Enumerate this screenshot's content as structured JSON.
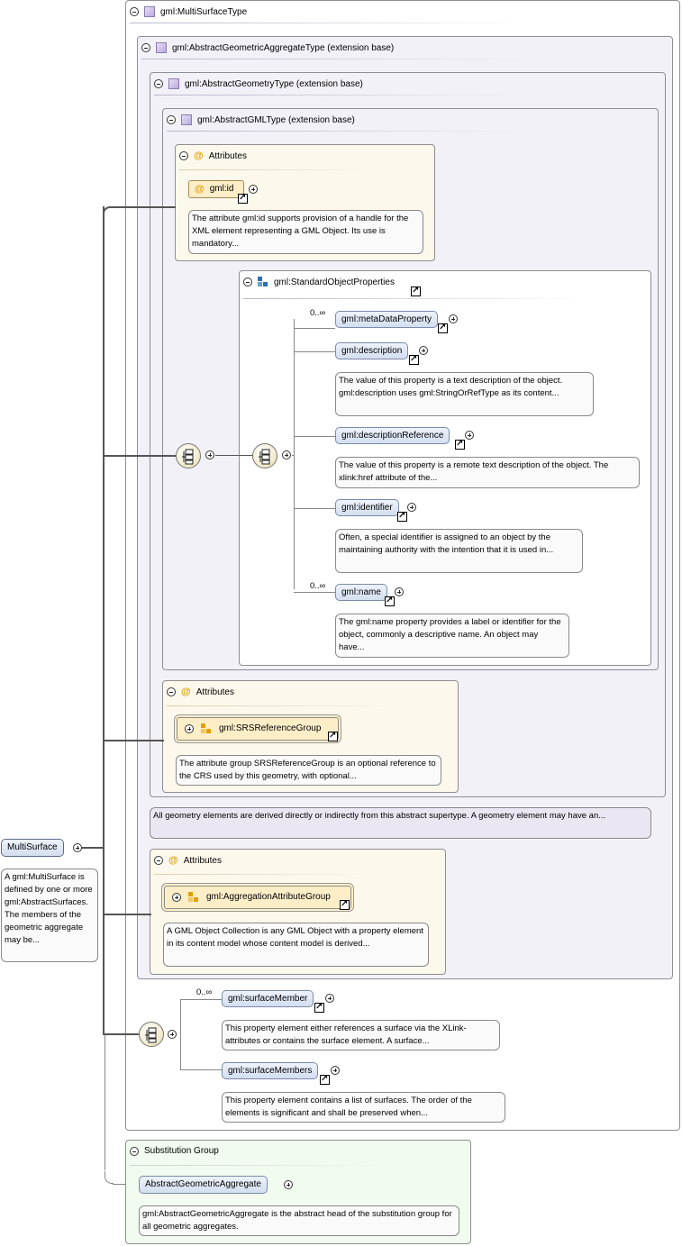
{
  "multisurface_type": {
    "title": "gml:MultiSurfaceType"
  },
  "aggregate_type": {
    "title": "gml:AbstractGeometricAggregateType (extension base)"
  },
  "geometry_type": {
    "title": "gml:AbstractGeometryType (extension base)"
  },
  "gml_type": {
    "title": "gml:AbstractGMLType (extension base)"
  },
  "attributes_1": {
    "title": "Attributes",
    "id_label": "gml:id",
    "id_doc": "The attribute gml:id supports provision of a handle for the XML element representing a GML Object. Its use is mandatory..."
  },
  "standard_props": {
    "title": "gml:StandardObjectProperties",
    "metadata_card": "0..∞",
    "metadata_label": "gml:metaDataProperty",
    "description_label": "gml:description",
    "description_doc": "The value of this property is a text description of the object. gml:description uses gml:StringOrRefType as its content...",
    "descref_label": "gml:descriptionReference",
    "descref_doc": "The value of this property is a remote text description of the object. The xlink:href attribute of the...",
    "identifier_label": "gml:identifier",
    "identifier_doc": "Often, a special identifier is assigned to an object by the maintaining authority with the intention that it is used in...",
    "name_card": "0..∞",
    "name_label": "gml:name",
    "name_doc": "The gml:name property provides a label or identifier for the object, commonly a descriptive name. An object may have..."
  },
  "attributes_2": {
    "title": "Attributes",
    "group_label": "gml:SRSReferenceGroup",
    "group_doc": "The attribute group SRSReferenceGroup is an optional reference to the CRS used by this geometry, with optional..."
  },
  "geometry_doc": "All geometry elements are derived directly or indirectly from this abstract supertype. A geometry element may have an...",
  "attributes_3": {
    "title": "Attributes",
    "group_label": "gml:AggregationAttributeGroup",
    "group_doc": "A GML Object Collection is any GML Object with a property element in its content model whose content model is derived..."
  },
  "root": {
    "label": "MultiSurface",
    "doc": "A gml:MultiSurface is defined by one or more gml:AbstractSurfaces. The members of the geometric aggregate may be..."
  },
  "surface_member": {
    "card": "0..∞",
    "label": "gml:surfaceMember",
    "doc": "This property element either references a surface via the XLink-attributes or contains the surface element. A surface..."
  },
  "surface_members": {
    "label": "gml:surfaceMembers",
    "doc": "This property element contains a list of surfaces. The order of the elements is significant and shall be preserved when..."
  },
  "substitution": {
    "title": "Substitution Group",
    "label": "AbstractGeometricAggregate",
    "doc": "gml:AbstractGeometricAggregate is the abstract head of the substitution group for all geometric aggregates."
  }
}
